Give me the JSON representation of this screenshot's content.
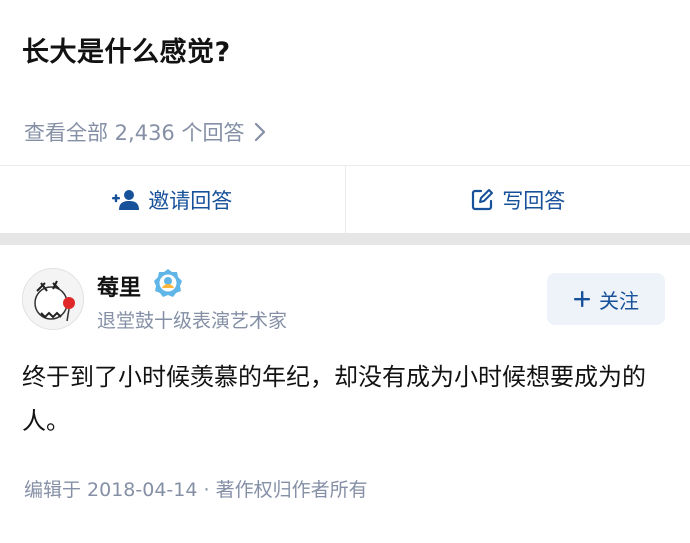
{
  "question": {
    "title": "长大是什么感觉?",
    "view_all_label": "查看全部 2,436 个回答"
  },
  "actions": {
    "invite_label": "邀请回答",
    "write_label": "写回答"
  },
  "answer": {
    "author_name": "莓里",
    "author_bio": "退堂鼓十级表演艺术家",
    "follow_label": "关注",
    "content": "终于到了小时候羡慕的年纪，却没有成为小时候想要成为的人。",
    "meta": "编辑于 2018-04-14 · 著作权归作者所有"
  },
  "icons": {
    "chevron": "chevron-right-icon",
    "invite": "add-person-icon",
    "write": "pencil-square-icon",
    "plus": "plus-icon",
    "badge": "verified-badge-icon"
  },
  "colors": {
    "link_blue": "#175199",
    "muted_gray": "#8590a6",
    "follow_bg": "#eef3fa",
    "divider": "#ebebeb"
  }
}
